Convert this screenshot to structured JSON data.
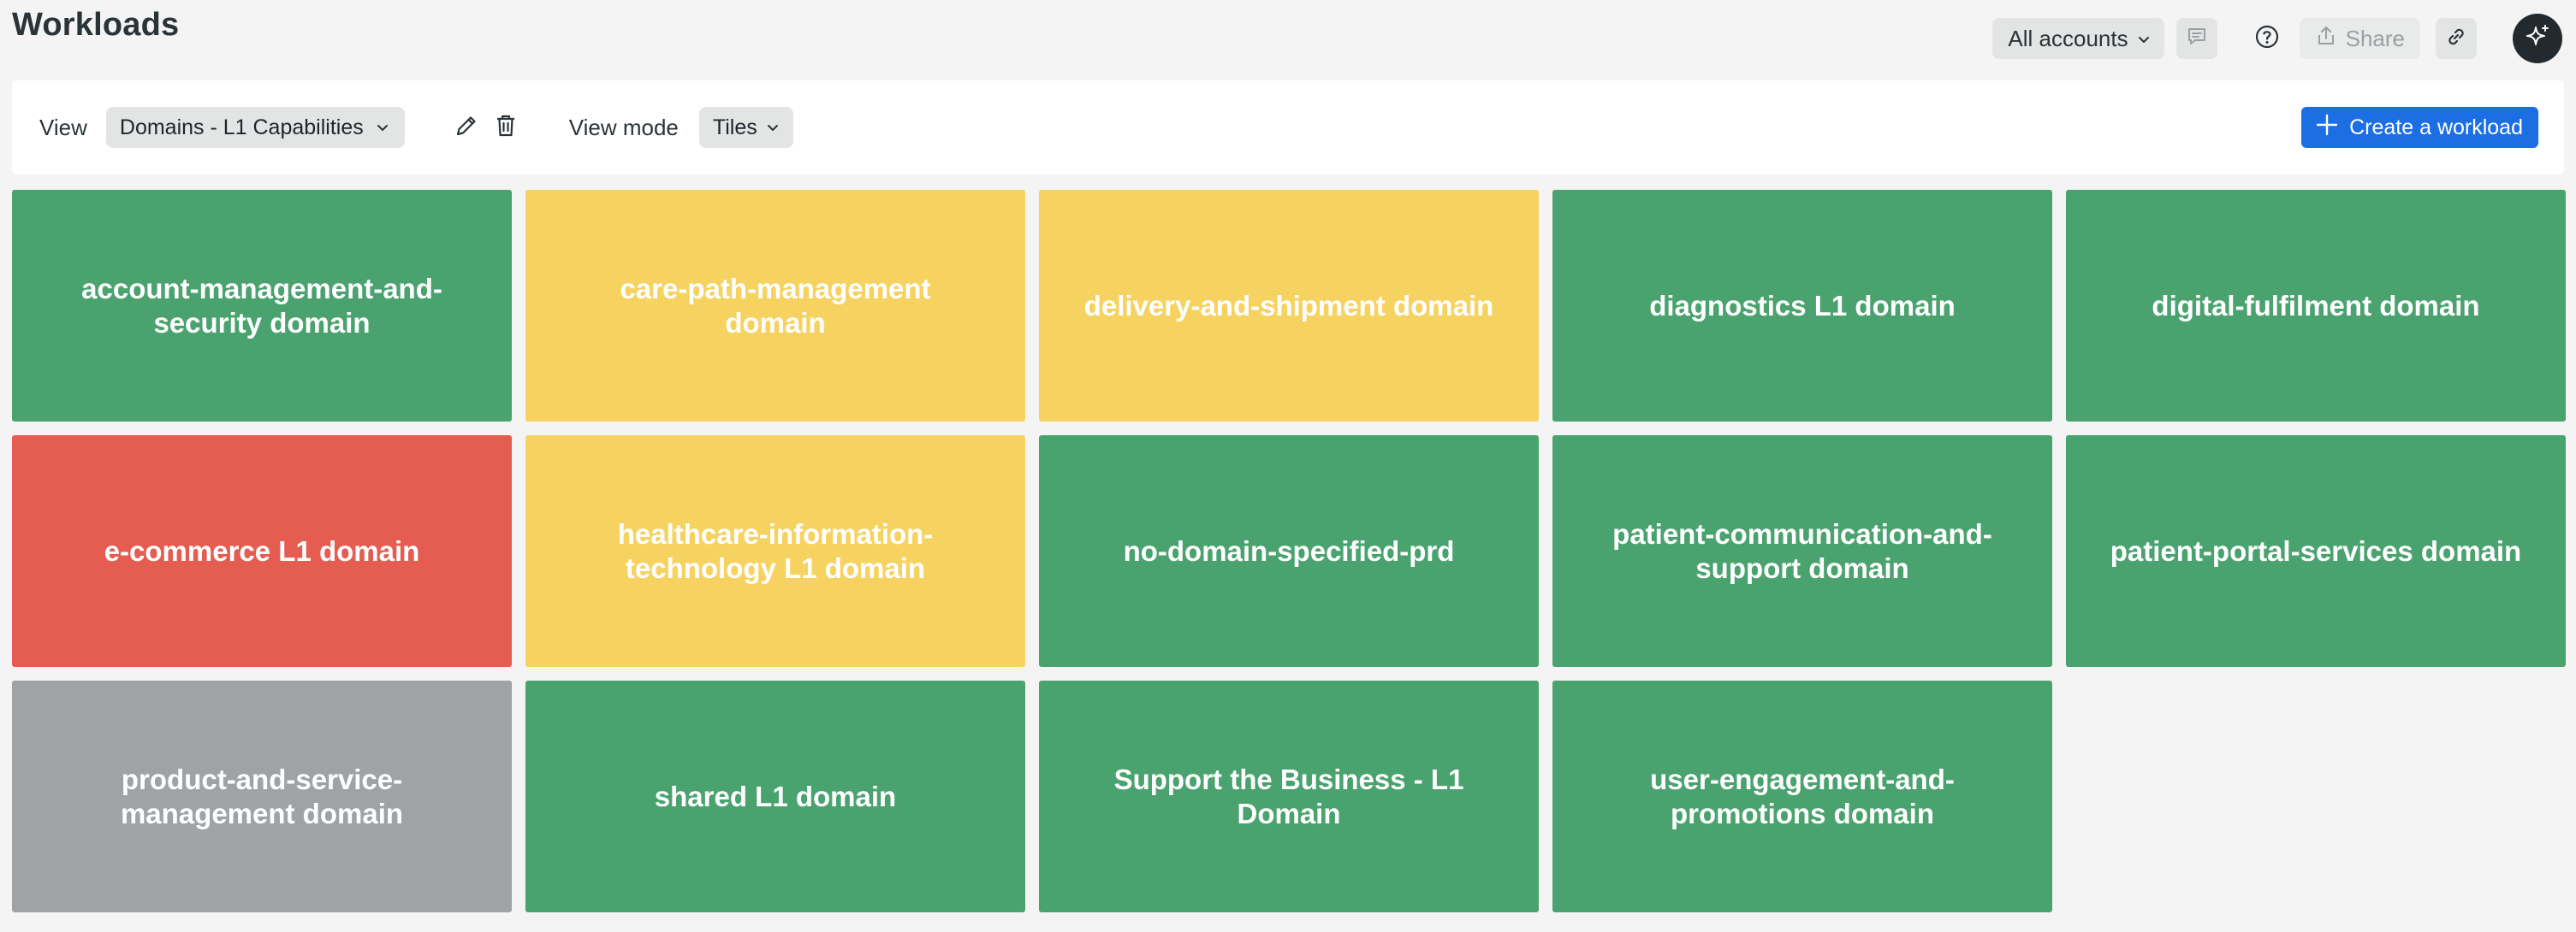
{
  "header": {
    "title": "Workloads",
    "accounts_label": "All accounts",
    "share_label": "Share",
    "icons": {
      "comment": "comment-icon",
      "help": "help-icon",
      "share": "share-icon",
      "link": "link-icon",
      "ai": "sparkle-icon"
    }
  },
  "toolbar": {
    "view_label": "View",
    "view_value": "Domains - L1 Capabilities",
    "view_mode_label": "View mode",
    "view_mode_value": "Tiles",
    "create_label": "Create a workload"
  },
  "colors": {
    "green": "#4aa36f",
    "yellow": "#f6d361",
    "red": "#e55d51",
    "gray": "#9fa3a6",
    "primary": "#1b6fe3"
  },
  "tiles": [
    {
      "label": "account-management-and-security domain",
      "status": "green"
    },
    {
      "label": "care-path-management domain",
      "status": "yellow"
    },
    {
      "label": "delivery-and-shipment domain",
      "status": "yellow"
    },
    {
      "label": "diagnostics L1 domain",
      "status": "green"
    },
    {
      "label": "digital-fulfilment domain",
      "status": "green"
    },
    {
      "label": "e-commerce L1 domain",
      "status": "red"
    },
    {
      "label": "healthcare-information-technology L1 domain",
      "status": "yellow"
    },
    {
      "label": "no-domain-specified-prd",
      "status": "green"
    },
    {
      "label": "patient-communication-and-support domain",
      "status": "green"
    },
    {
      "label": "patient-portal-services domain",
      "status": "green"
    },
    {
      "label": "product-and-service-management domain",
      "status": "gray"
    },
    {
      "label": "shared L1 domain",
      "status": "green"
    },
    {
      "label": "Support the Business - L1 Domain",
      "status": "green"
    },
    {
      "label": "user-engagement-and-promotions domain",
      "status": "green"
    }
  ]
}
